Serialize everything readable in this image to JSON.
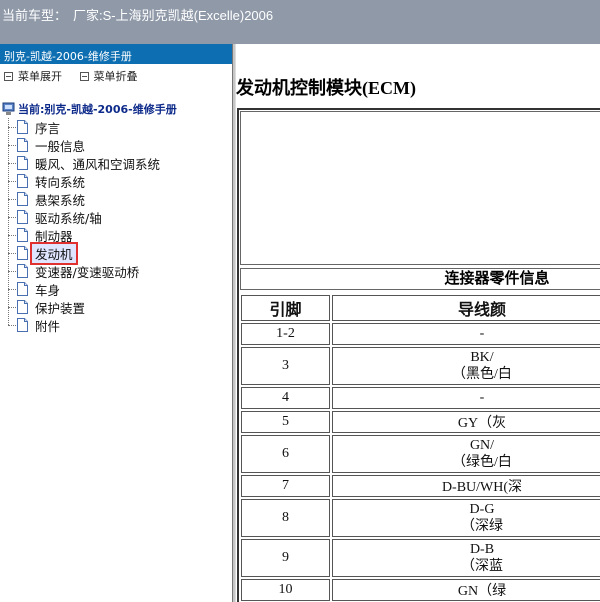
{
  "topbar": {
    "label": "当前车型：",
    "value": "厂家:S-上海别克凯越(Excelle)2006"
  },
  "sidebar": {
    "title": "别克-凯越-2006-维修手册",
    "tools": [
      {
        "label": "菜单展开"
      },
      {
        "label": "菜单折叠"
      }
    ],
    "root": "当前:别克-凯越-2006-维修手册",
    "items": [
      {
        "label": "序言"
      },
      {
        "label": "一般信息"
      },
      {
        "label": "暖风、通风和空调系统"
      },
      {
        "label": "转向系统"
      },
      {
        "label": "悬架系统"
      },
      {
        "label": "驱动系统/轴"
      },
      {
        "label": "制动器"
      },
      {
        "label": "发动机",
        "selected": true
      },
      {
        "label": "变速器/变速驱动桥"
      },
      {
        "label": "车身"
      },
      {
        "label": "保护装置"
      },
      {
        "label": "附件"
      }
    ]
  },
  "content": {
    "title": "发动机控制模块(ECM)",
    "section": "连接器零件信息",
    "headers": {
      "pin": "引脚",
      "wire": "导线颜"
    },
    "rows": [
      {
        "pin": "1-2",
        "l1": "-",
        "l2": ""
      },
      {
        "pin": "3",
        "l1": "BK/",
        "l2": "（黑色/白"
      },
      {
        "pin": "4",
        "l1": "-",
        "l2": ""
      },
      {
        "pin": "5",
        "l1": "GY（灰",
        "l2": ""
      },
      {
        "pin": "6",
        "l1": "GN/",
        "l2": "（绿色/白"
      },
      {
        "pin": "7",
        "l1": "D-BU/WH(深",
        "l2": ""
      },
      {
        "pin": "8",
        "l1": "D-G",
        "l2": "（深绿"
      },
      {
        "pin": "9",
        "l1": "D-B",
        "l2": "（深蓝"
      },
      {
        "pin": "10",
        "l1": "GN（绿",
        "l2": ""
      }
    ]
  }
}
